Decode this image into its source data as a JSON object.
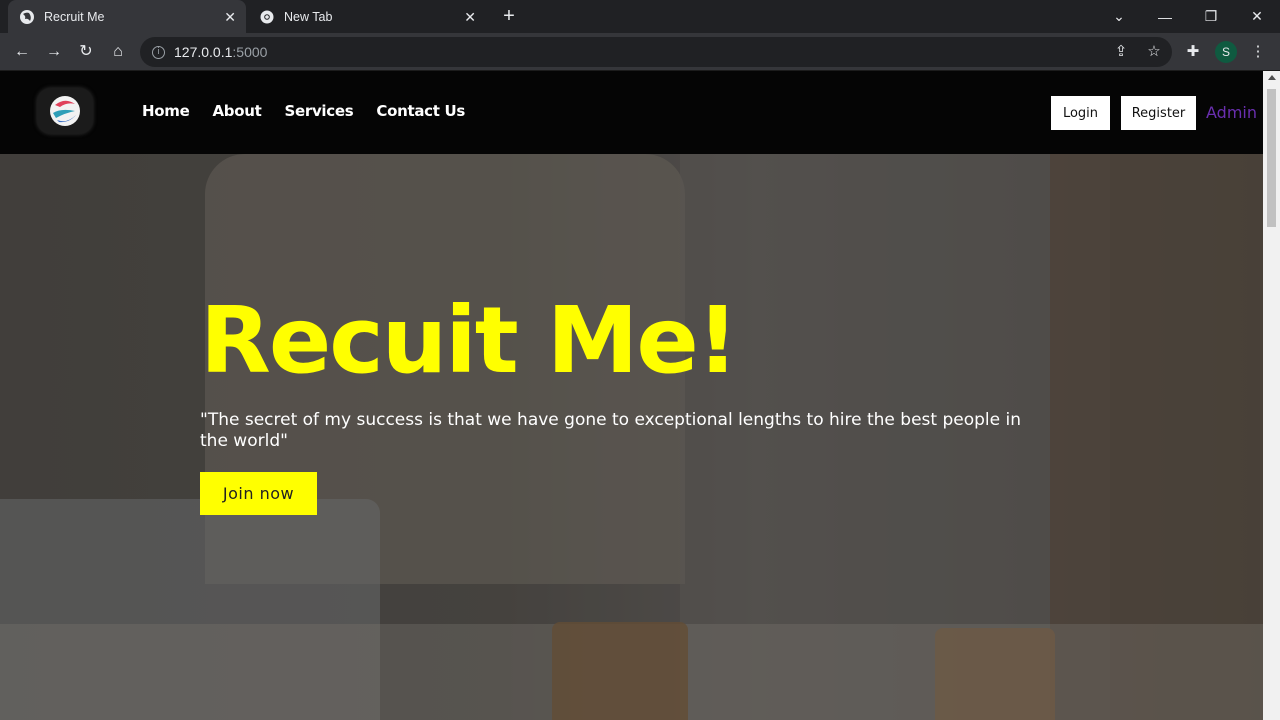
{
  "browser": {
    "tabs": [
      {
        "title": "Recruit Me",
        "active": true
      },
      {
        "title": "New Tab",
        "active": false
      }
    ],
    "address": {
      "host": "127.0.0.1",
      "port": ":5000"
    },
    "profile_initial": "S"
  },
  "site": {
    "nav": {
      "links": [
        "Home",
        "About",
        "Services",
        "Contact Us"
      ],
      "login_label": "Login",
      "register_label": "Register",
      "admin_label": "Admin"
    },
    "hero": {
      "title": "Recuit Me!",
      "quote": "\"The secret of my success is that we have gone to exceptional lengths to hire the best people in the world\"",
      "cta_label": "Join now"
    }
  },
  "colors": {
    "accent": "#ffff00",
    "admin": "#6a2fb0",
    "nav_bg": "#050505"
  }
}
